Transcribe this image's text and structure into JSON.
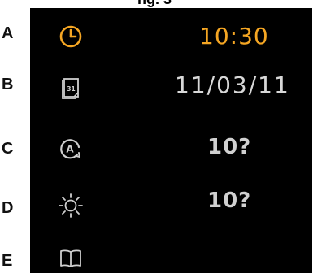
{
  "header_fragment": "ng. 3",
  "rows": [
    {
      "letter": "A",
      "icon": "clock-icon",
      "value": "10:30"
    },
    {
      "letter": "B",
      "icon": "calendar-icon",
      "icon_text": "31",
      "value": "11/03/11"
    },
    {
      "letter": "C",
      "icon": "auto-brightness-icon",
      "icon_text": "A",
      "value": "10?"
    },
    {
      "letter": "D",
      "icon": "sun-icon",
      "value": "10?"
    },
    {
      "letter": "E",
      "icon": "book-icon",
      "value": ""
    }
  ],
  "colors": {
    "panel_background": "#000000",
    "accent_orange": "#f5a623",
    "value_grey": "#d0d0d0",
    "icon_grey": "#cfcfcf"
  }
}
